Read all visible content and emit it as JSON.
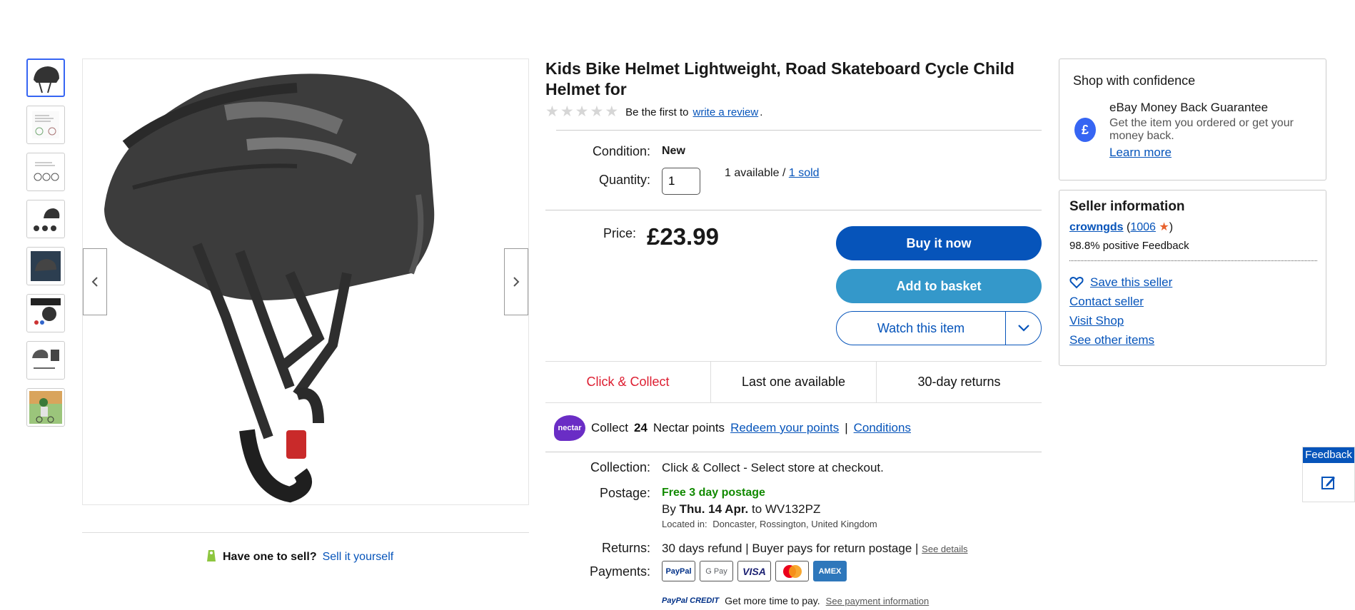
{
  "listing": {
    "title": "Kids Bike Helmet Lightweight, Road Skateboard Cycle Child Helmet for",
    "review_prefix": "Be the first to",
    "review_link": "write a review",
    "review_suffix": "."
  },
  "gallery": {
    "thumbnail_count": 8,
    "active_index": 0
  },
  "sell": {
    "prompt": "Have one to sell?",
    "link": "Sell it yourself"
  },
  "details": {
    "condition_label": "Condition:",
    "condition_value": "New",
    "quantity_label": "Quantity:",
    "quantity_value": "1",
    "available_text": "1 available /",
    "sold_link": "1 sold",
    "price_label": "Price:",
    "price_value": "£23.99"
  },
  "actions": {
    "buy_now": "Buy it now",
    "add_to_basket": "Add to basket",
    "watch": "Watch this item"
  },
  "badges": [
    "Click & Collect",
    "Last one available",
    "30-day returns"
  ],
  "nectar": {
    "logo_text": "nectar",
    "collect": "Collect",
    "points": "24",
    "points_suffix": "Nectar points",
    "redeem_link": "Redeem your points",
    "separator": "|",
    "conditions_link": "Conditions"
  },
  "shipping": {
    "collection_label": "Collection:",
    "collection_value": "Click & Collect - Select store at checkout.",
    "postage_label": "Postage:",
    "postage_free": "Free 3 day postage",
    "by": "By",
    "date": "Thu. 14 Apr.",
    "to": "to WV132PZ",
    "located_label": "Located in:",
    "located_value": "Doncaster, Rossington, United Kingdom",
    "returns_label": "Returns:",
    "returns_value": "30 days refund | Buyer pays for return postage |",
    "returns_link": "See details",
    "payments_label": "Payments:",
    "cards": [
      "PayPal",
      "G Pay",
      "VISA",
      "Mastercard",
      "AMEX"
    ],
    "credit_logo": "PayPal CREDIT",
    "credit_text": "Get more time to pay.",
    "credit_link": "See payment information"
  },
  "confidence": {
    "heading": "Shop with confidence",
    "guarantee_title": "eBay Money Back Guarantee",
    "guarantee_text": "Get the item you ordered or get your money back.",
    "learn_more": "Learn more",
    "shield_glyph": "£"
  },
  "seller": {
    "heading": "Seller information",
    "name": "crowngds",
    "feedback_count": "1006",
    "positive": "98.8% positive Feedback",
    "save": "Save this seller",
    "contact": "Contact seller",
    "visit": "Visit Shop",
    "other": "See other items"
  },
  "feedback_tab": {
    "label": "Feedback"
  },
  "colors": {
    "primary": "#0654ba",
    "basket": "#3498ca",
    "red": "#dd1e31",
    "green": "#118a00",
    "nectar": "#6a2dc5"
  }
}
